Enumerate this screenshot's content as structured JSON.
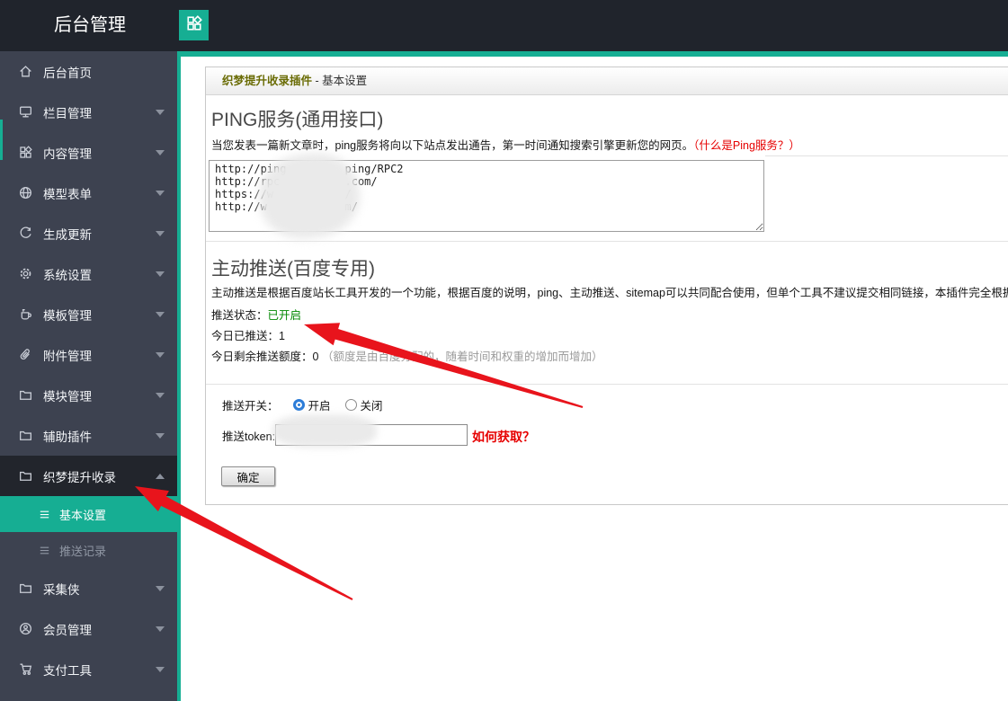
{
  "topbar": {
    "title": "后台管理"
  },
  "sidebar": {
    "items": [
      {
        "label": "后台首页"
      },
      {
        "label": "栏目管理"
      },
      {
        "label": "内容管理"
      },
      {
        "label": "模型表单"
      },
      {
        "label": "生成更新"
      },
      {
        "label": "系统设置"
      },
      {
        "label": "模板管理"
      },
      {
        "label": "附件管理"
      },
      {
        "label": "模块管理"
      },
      {
        "label": "辅助插件"
      },
      {
        "label": "织梦提升收录",
        "expanded": true
      },
      {
        "label": "采集侠"
      },
      {
        "label": "会员管理"
      },
      {
        "label": "支付工具"
      }
    ],
    "submenu": [
      {
        "label": "基本设置",
        "active": true
      },
      {
        "label": "推送记录",
        "active": false
      }
    ]
  },
  "panel": {
    "breadcrumb": {
      "plugin": "织梦提升收录插件",
      "separator": " - ",
      "page": "基本设置"
    },
    "ping": {
      "title": "PING服务(通用接口)",
      "desc": "当您发表一篇新文章时，ping服务将向以下站点发出通告，第一时间通知搜索引擎更新您的网页。",
      "help_link": "（什么是Ping服务？）",
      "urls": "http://ping         ping/RPC2\nhttp://rpc          .com/\nhttps://w           /\nhttp://w            m/",
      "censored": true
    },
    "push": {
      "title": "主动推送(百度专用)",
      "desc": "主动推送是根据百度站长工具开发的一个功能，根据百度的说明，ping、主动推送、sitemap可以共同配合使用，但单个工具不建议提交相同链接，本插件完全根据百度",
      "status_label": "推送状态：",
      "status_value": "已开启",
      "today_label": "今日已推送：",
      "today_value": "1",
      "quota_label": "今日剩余推送额度：",
      "quota_value": "0",
      "quota_note": "（额度是由百度分配的，随着时间和权重的增加而增加）"
    },
    "form": {
      "switch_label": "推送开关：",
      "option_on": "开启",
      "option_off": "关闭",
      "switch_value": "开启",
      "token_label": "推送token:",
      "token_value": "",
      "token_censored": true,
      "help_link": "如何获取？",
      "submit_label": "确定"
    }
  },
  "colors": {
    "accent": "#16ae93",
    "topbar": "#20242c",
    "sidebar": "#3d4250",
    "red": "#e60000",
    "green": "#008800",
    "olive": "#6a6c05"
  }
}
